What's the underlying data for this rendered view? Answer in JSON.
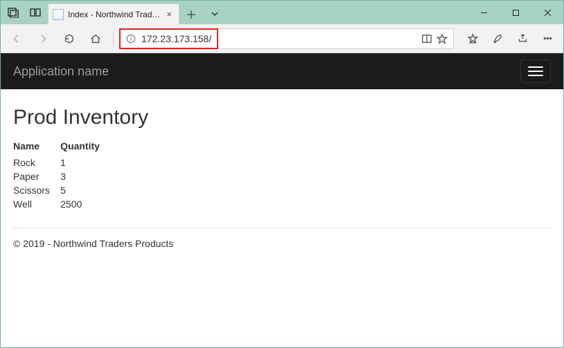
{
  "browser": {
    "tab_title": "Index - Northwind Traders",
    "url": "172.23.173.158/"
  },
  "navbar": {
    "brand": "Application name"
  },
  "page": {
    "heading": "Prod Inventory",
    "columns": {
      "name": "Name",
      "quantity": "Quantity"
    },
    "rows": [
      {
        "name": "Rock",
        "qty": "1"
      },
      {
        "name": "Paper",
        "qty": "3"
      },
      {
        "name": "Scissors",
        "qty": "5"
      },
      {
        "name": "Well",
        "qty": "2500"
      }
    ],
    "footer": "© 2019 - Northwind Traders Products"
  }
}
